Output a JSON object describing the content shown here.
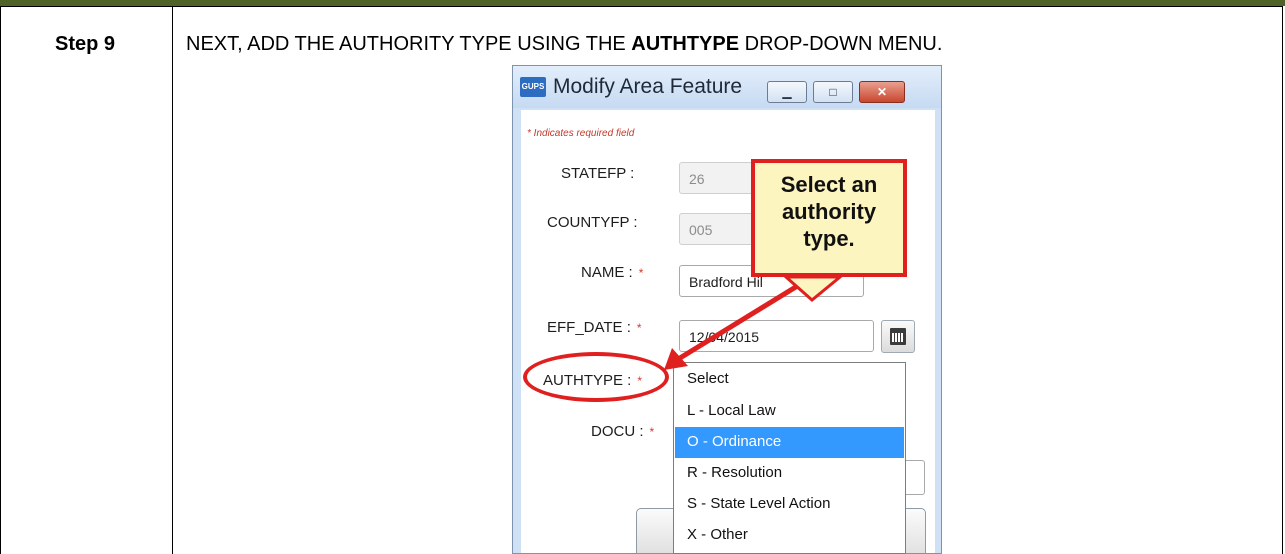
{
  "step": {
    "label": "Step 9",
    "instruction_before": "NEXT, ADD THE AUTHORITY TYPE USING THE ",
    "instruction_bold": "AUTHTYPE",
    "instruction_after": " DROP-DOWN MENU."
  },
  "dialog": {
    "app_icon_text": "GUPS",
    "title": "Modify Area Feature",
    "required_note": "* Indicates required field",
    "fields": {
      "statefp_label": "STATEFP :",
      "statefp_value": "26",
      "countyfp_label": "COUNTYFP :",
      "countyfp_value": "005",
      "name_label": "NAME :",
      "name_value": "Bradford Hil",
      "eff_date_label": "EFF_DATE :",
      "eff_date_value": "12/04/2015",
      "authtype_label": "AUTHTYPE :",
      "docu_label": "DOCU :",
      "required_marker": "*"
    },
    "authtype_options": [
      {
        "label": "Select",
        "selected": false
      },
      {
        "label": "L - Local Law",
        "selected": false
      },
      {
        "label": "O - Ordinance",
        "selected": true
      },
      {
        "label": "R - Resolution",
        "selected": false
      },
      {
        "label": "S - State Level Action",
        "selected": false
      },
      {
        "label": "X - Other",
        "selected": false
      }
    ]
  },
  "callout": {
    "line1": "Select an",
    "line2": "authority",
    "line3": "type."
  },
  "colors": {
    "callout_border": "#e01f1f",
    "callout_fill": "#fdf5c0",
    "selection": "#3399ff",
    "header_strip": "#4f6228"
  }
}
